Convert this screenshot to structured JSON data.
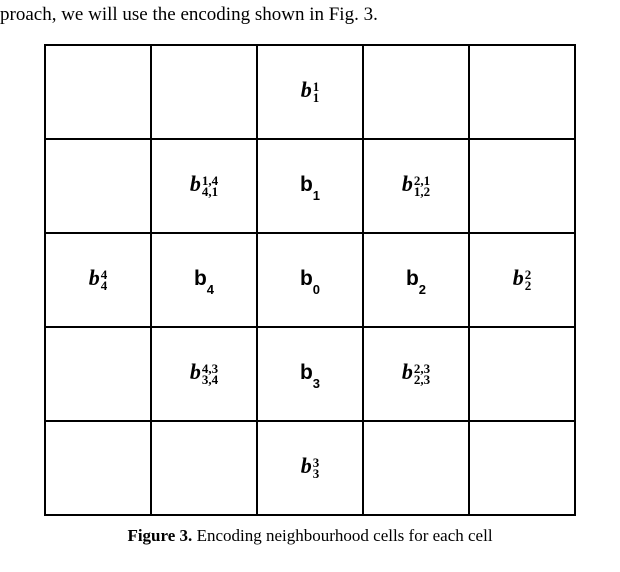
{
  "intro_text": "proach, we will use the encoding shown in Fig. 3.",
  "grid": {
    "cells": [
      [
        {
          "type": "empty"
        },
        {
          "type": "empty"
        },
        {
          "type": "bss",
          "base": "b",
          "sub": "1",
          "sup": "1"
        },
        {
          "type": "empty"
        },
        {
          "type": "empty"
        }
      ],
      [
        {
          "type": "empty"
        },
        {
          "type": "bss",
          "base": "b",
          "sub": "4,1",
          "sup": "1,4"
        },
        {
          "type": "bsans",
          "base": "b",
          "sub": "1"
        },
        {
          "type": "bss",
          "base": "b",
          "sub": "1,2",
          "sup": "2,1"
        },
        {
          "type": "empty"
        }
      ],
      [
        {
          "type": "bss",
          "base": "b",
          "sub": "4",
          "sup": "4"
        },
        {
          "type": "bsans",
          "base": "b",
          "sub": "4"
        },
        {
          "type": "bsans",
          "base": "b",
          "sub": "0"
        },
        {
          "type": "bsans",
          "base": "b",
          "sub": "2"
        },
        {
          "type": "bss",
          "base": "b",
          "sub": "2",
          "sup": "2"
        }
      ],
      [
        {
          "type": "empty"
        },
        {
          "type": "bss",
          "base": "b",
          "sub": "3,4",
          "sup": "4,3"
        },
        {
          "type": "bsans",
          "base": "b",
          "sub": "3"
        },
        {
          "type": "bss",
          "base": "b",
          "sub": "2,3",
          "sup": "2,3"
        },
        {
          "type": "empty"
        }
      ],
      [
        {
          "type": "empty"
        },
        {
          "type": "empty"
        },
        {
          "type": "bss",
          "base": "b",
          "sub": "3",
          "sup": "3"
        },
        {
          "type": "empty"
        },
        {
          "type": "empty"
        }
      ]
    ]
  },
  "caption": {
    "label": "Figure 3.",
    "text": " Encoding neighbourhood cells for each cell"
  }
}
